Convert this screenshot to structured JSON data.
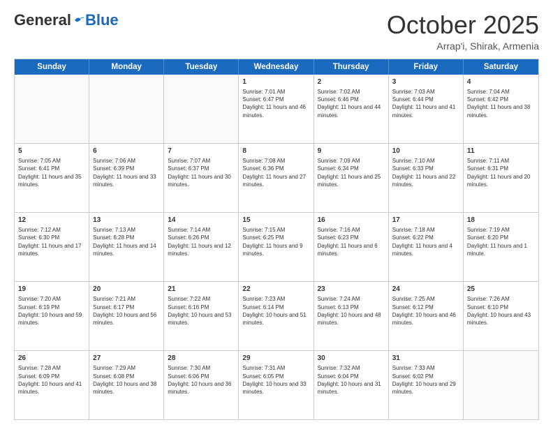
{
  "header": {
    "logo_general": "General",
    "logo_blue": "Blue",
    "month_title": "October 2025",
    "location": "Arrap'i, Shirak, Armenia"
  },
  "days_of_week": [
    "Sunday",
    "Monday",
    "Tuesday",
    "Wednesday",
    "Thursday",
    "Friday",
    "Saturday"
  ],
  "weeks": [
    [
      {
        "day": "",
        "empty": true
      },
      {
        "day": "",
        "empty": true
      },
      {
        "day": "",
        "empty": true
      },
      {
        "day": "1",
        "sunrise": "Sunrise: 7:01 AM",
        "sunset": "Sunset: 6:47 PM",
        "daylight": "Daylight: 11 hours and 46 minutes."
      },
      {
        "day": "2",
        "sunrise": "Sunrise: 7:02 AM",
        "sunset": "Sunset: 6:46 PM",
        "daylight": "Daylight: 11 hours and 44 minutes."
      },
      {
        "day": "3",
        "sunrise": "Sunrise: 7:03 AM",
        "sunset": "Sunset: 6:44 PM",
        "daylight": "Daylight: 11 hours and 41 minutes."
      },
      {
        "day": "4",
        "sunrise": "Sunrise: 7:04 AM",
        "sunset": "Sunset: 6:42 PM",
        "daylight": "Daylight: 11 hours and 38 minutes."
      }
    ],
    [
      {
        "day": "5",
        "sunrise": "Sunrise: 7:05 AM",
        "sunset": "Sunset: 6:41 PM",
        "daylight": "Daylight: 11 hours and 35 minutes."
      },
      {
        "day": "6",
        "sunrise": "Sunrise: 7:06 AM",
        "sunset": "Sunset: 6:39 PM",
        "daylight": "Daylight: 11 hours and 33 minutes."
      },
      {
        "day": "7",
        "sunrise": "Sunrise: 7:07 AM",
        "sunset": "Sunset: 6:37 PM",
        "daylight": "Daylight: 11 hours and 30 minutes."
      },
      {
        "day": "8",
        "sunrise": "Sunrise: 7:08 AM",
        "sunset": "Sunset: 6:36 PM",
        "daylight": "Daylight: 11 hours and 27 minutes."
      },
      {
        "day": "9",
        "sunrise": "Sunrise: 7:09 AM",
        "sunset": "Sunset: 6:34 PM",
        "daylight": "Daylight: 11 hours and 25 minutes."
      },
      {
        "day": "10",
        "sunrise": "Sunrise: 7:10 AM",
        "sunset": "Sunset: 6:33 PM",
        "daylight": "Daylight: 11 hours and 22 minutes."
      },
      {
        "day": "11",
        "sunrise": "Sunrise: 7:11 AM",
        "sunset": "Sunset: 6:31 PM",
        "daylight": "Daylight: 11 hours and 20 minutes."
      }
    ],
    [
      {
        "day": "12",
        "sunrise": "Sunrise: 7:12 AM",
        "sunset": "Sunset: 6:30 PM",
        "daylight": "Daylight: 11 hours and 17 minutes."
      },
      {
        "day": "13",
        "sunrise": "Sunrise: 7:13 AM",
        "sunset": "Sunset: 6:28 PM",
        "daylight": "Daylight: 11 hours and 14 minutes."
      },
      {
        "day": "14",
        "sunrise": "Sunrise: 7:14 AM",
        "sunset": "Sunset: 6:26 PM",
        "daylight": "Daylight: 11 hours and 12 minutes."
      },
      {
        "day": "15",
        "sunrise": "Sunrise: 7:15 AM",
        "sunset": "Sunset: 6:25 PM",
        "daylight": "Daylight: 11 hours and 9 minutes."
      },
      {
        "day": "16",
        "sunrise": "Sunrise: 7:16 AM",
        "sunset": "Sunset: 6:23 PM",
        "daylight": "Daylight: 11 hours and 6 minutes."
      },
      {
        "day": "17",
        "sunrise": "Sunrise: 7:18 AM",
        "sunset": "Sunset: 6:22 PM",
        "daylight": "Daylight: 11 hours and 4 minutes."
      },
      {
        "day": "18",
        "sunrise": "Sunrise: 7:19 AM",
        "sunset": "Sunset: 6:20 PM",
        "daylight": "Daylight: 11 hours and 1 minute."
      }
    ],
    [
      {
        "day": "19",
        "sunrise": "Sunrise: 7:20 AM",
        "sunset": "Sunset: 6:19 PM",
        "daylight": "Daylight: 10 hours and 59 minutes."
      },
      {
        "day": "20",
        "sunrise": "Sunrise: 7:21 AM",
        "sunset": "Sunset: 6:17 PM",
        "daylight": "Daylight: 10 hours and 56 minutes."
      },
      {
        "day": "21",
        "sunrise": "Sunrise: 7:22 AM",
        "sunset": "Sunset: 6:16 PM",
        "daylight": "Daylight: 10 hours and 53 minutes."
      },
      {
        "day": "22",
        "sunrise": "Sunrise: 7:23 AM",
        "sunset": "Sunset: 6:14 PM",
        "daylight": "Daylight: 10 hours and 51 minutes."
      },
      {
        "day": "23",
        "sunrise": "Sunrise: 7:24 AM",
        "sunset": "Sunset: 6:13 PM",
        "daylight": "Daylight: 10 hours and 48 minutes."
      },
      {
        "day": "24",
        "sunrise": "Sunrise: 7:25 AM",
        "sunset": "Sunset: 6:12 PM",
        "daylight": "Daylight: 10 hours and 46 minutes."
      },
      {
        "day": "25",
        "sunrise": "Sunrise: 7:26 AM",
        "sunset": "Sunset: 6:10 PM",
        "daylight": "Daylight: 10 hours and 43 minutes."
      }
    ],
    [
      {
        "day": "26",
        "sunrise": "Sunrise: 7:28 AM",
        "sunset": "Sunset: 6:09 PM",
        "daylight": "Daylight: 10 hours and 41 minutes."
      },
      {
        "day": "27",
        "sunrise": "Sunrise: 7:29 AM",
        "sunset": "Sunset: 6:08 PM",
        "daylight": "Daylight: 10 hours and 38 minutes."
      },
      {
        "day": "28",
        "sunrise": "Sunrise: 7:30 AM",
        "sunset": "Sunset: 6:06 PM",
        "daylight": "Daylight: 10 hours and 36 minutes."
      },
      {
        "day": "29",
        "sunrise": "Sunrise: 7:31 AM",
        "sunset": "Sunset: 6:05 PM",
        "daylight": "Daylight: 10 hours and 33 minutes."
      },
      {
        "day": "30",
        "sunrise": "Sunrise: 7:32 AM",
        "sunset": "Sunset: 6:04 PM",
        "daylight": "Daylight: 10 hours and 31 minutes."
      },
      {
        "day": "31",
        "sunrise": "Sunrise: 7:33 AM",
        "sunset": "Sunset: 6:02 PM",
        "daylight": "Daylight: 10 hours and 29 minutes."
      },
      {
        "day": "",
        "empty": true
      }
    ]
  ]
}
